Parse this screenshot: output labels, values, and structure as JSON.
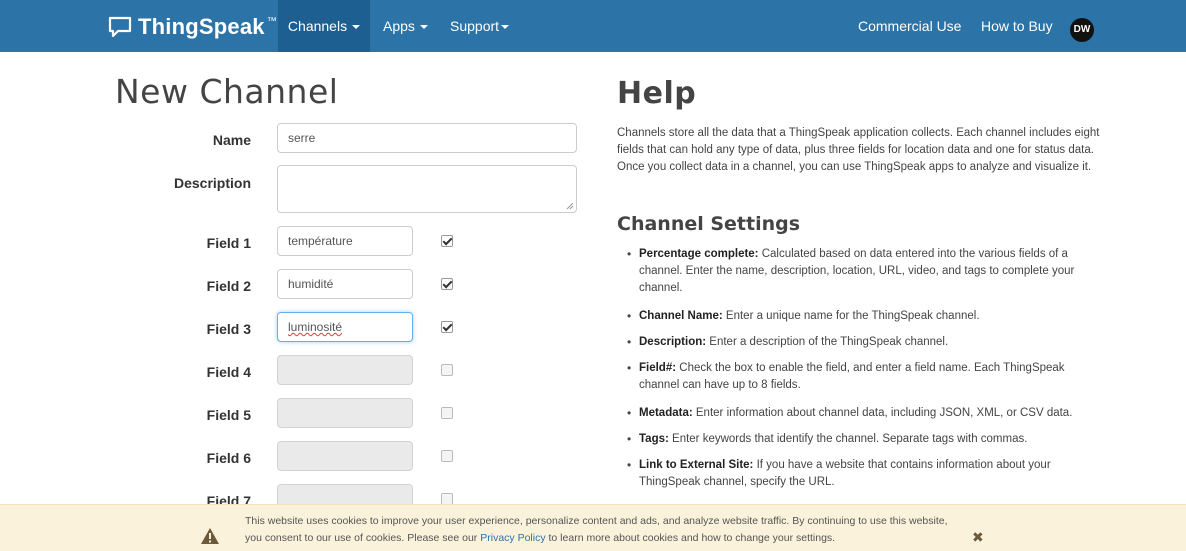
{
  "navbar": {
    "brand": "ThingSpeak",
    "brand_tm": "™",
    "channels": "Channels",
    "apps": "Apps",
    "support": "Support",
    "commercial_use": "Commercial Use",
    "how_to_buy": "How to Buy",
    "avatar": "DW"
  },
  "form": {
    "title": "New Channel",
    "name_label": "Name",
    "name_value": "serre",
    "description_label": "Description",
    "description_value": "",
    "fields": [
      {
        "label": "Field 1",
        "value": "température",
        "checked": true
      },
      {
        "label": "Field 2",
        "value": "humidité",
        "checked": true
      },
      {
        "label": "Field 3",
        "value": "luminosité",
        "checked": true
      },
      {
        "label": "Field 4",
        "value": "",
        "checked": false
      },
      {
        "label": "Field 5",
        "value": "",
        "checked": false
      },
      {
        "label": "Field 6",
        "value": "",
        "checked": false
      },
      {
        "label": "Field 7",
        "value": "",
        "checked": false
      }
    ]
  },
  "help": {
    "title": "Help",
    "intro": "Channels store all the data that a ThingSpeak application collects. Each channel includes eight fields that can hold any type of data, plus three fields for location data and one for status data. Once you collect data in a channel, you can use ThingSpeak apps to analyze and visualize it.",
    "settings_title": "Channel Settings",
    "items": [
      {
        "term": "Percentage complete:",
        "text": " Calculated based on data entered into the various fields of a channel. Enter the name, description, location, URL, video, and tags to complete your channel."
      },
      {
        "term": "Channel Name:",
        "text": " Enter a unique name for the ThingSpeak channel."
      },
      {
        "term": "Description:",
        "text": " Enter a description of the ThingSpeak channel."
      },
      {
        "term": "Field#:",
        "text": " Check the box to enable the field, and enter a field name. Each ThingSpeak channel can have up to 8 fields."
      },
      {
        "term": "Metadata:",
        "text": " Enter information about channel data, including JSON, XML, or CSV data."
      },
      {
        "term": "Tags:",
        "text": " Enter keywords that identify the channel. Separate tags with commas."
      },
      {
        "term": "Link to External Site:",
        "text": " If you have a website that contains information about your ThingSpeak channel, specify the URL."
      }
    ]
  },
  "cookie": {
    "line1": "This website uses cookies to improve your user experience, personalize content and ads, and analyze website traffic. By continuing to use this website,",
    "line2_before": "you consent to our use of cookies. Please see our ",
    "link": "Privacy Policy",
    "line2_after": " to learn more about cookies and how to change your settings.",
    "close": "✖"
  },
  "colors": {
    "navbar": "#2c73a7",
    "navbar_active": "#1d5f91",
    "cookie_bg": "#fbf2dc",
    "link": "#2c73a7"
  }
}
